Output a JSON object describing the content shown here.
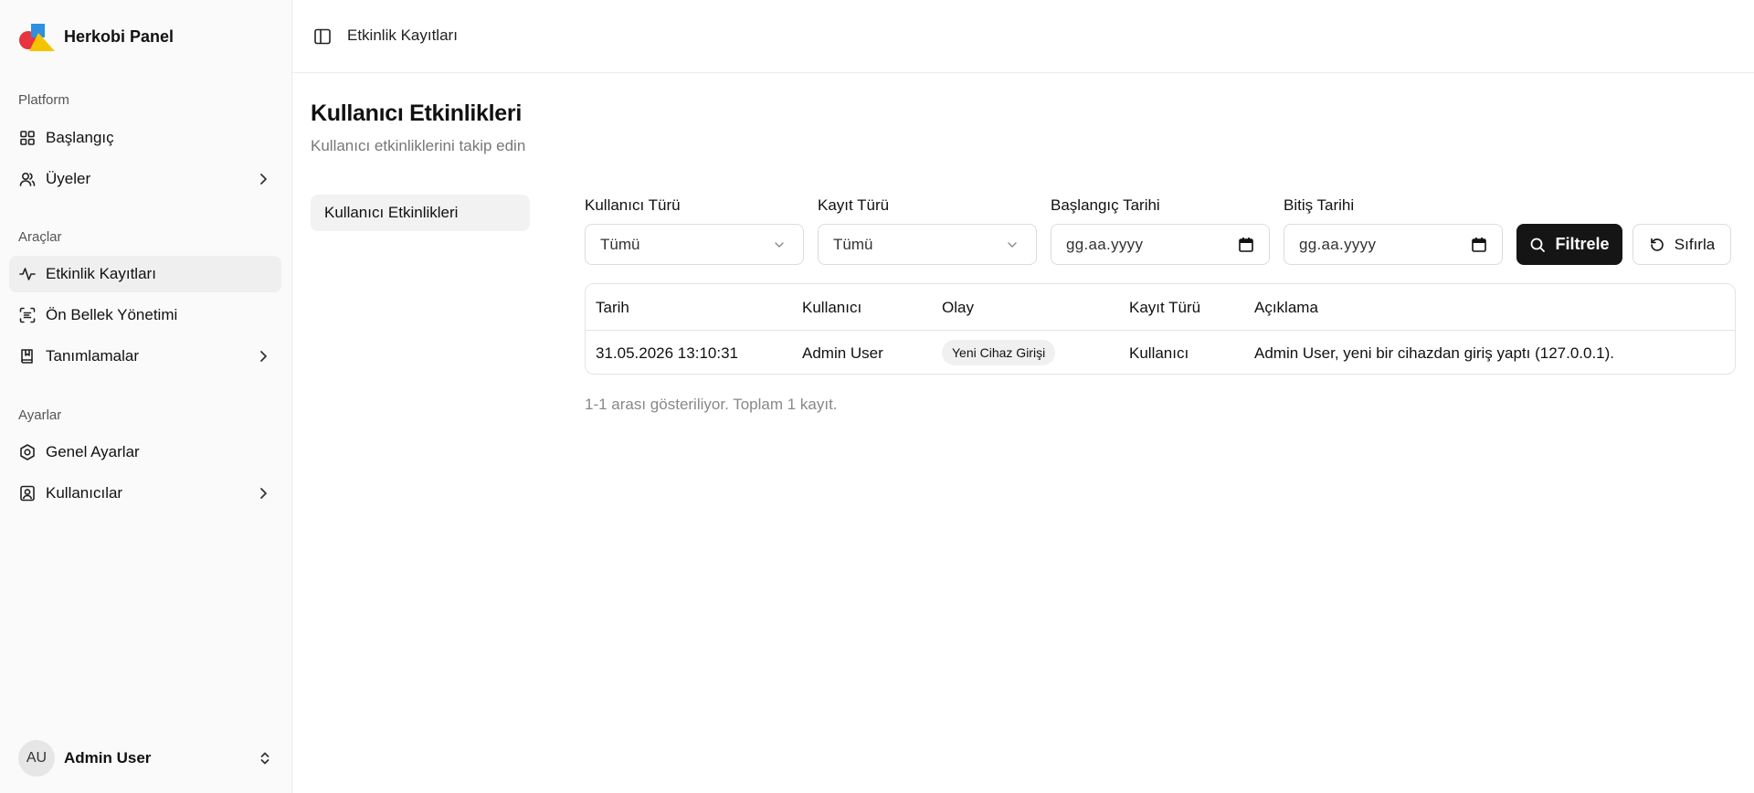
{
  "app": {
    "name": "Herkobi Panel"
  },
  "sidebar": {
    "groups": [
      {
        "label": "Platform"
      },
      {
        "label": "Araçlar"
      },
      {
        "label": "Ayarlar"
      }
    ],
    "items": [
      {
        "label": "Başlangıç",
        "icon": "grid-icon"
      },
      {
        "label": "Üyeler",
        "icon": "users-icon"
      },
      {
        "label": "Etkinlik Kayıtları",
        "icon": "activity-icon",
        "active": true
      },
      {
        "label": "Ön Bellek Yönetimi",
        "icon": "scan-text-icon"
      },
      {
        "label": "Tanımlamalar",
        "icon": "book-icon"
      },
      {
        "label": "Genel Ayarlar",
        "icon": "hexagon-settings-icon"
      },
      {
        "label": "Kullanıcılar",
        "icon": "contact-icon"
      }
    ],
    "user": {
      "initials": "AU",
      "name": "Admin User"
    }
  },
  "header": {
    "title": "Etkinlik Kayıtları"
  },
  "page": {
    "title": "Kullanıcı Etkinlikleri",
    "subtitle": "Kullanıcı etkinliklerini takip edin",
    "subnav": {
      "label": "Kullanıcı Etkinlikleri"
    }
  },
  "filters": {
    "user_type": {
      "label": "Kullanıcı Türü",
      "value": "Tümü"
    },
    "log_type": {
      "label": "Kayıt Türü",
      "value": "Tümü"
    },
    "start_date": {
      "label": "Başlangıç Tarihi",
      "placeholder": "gg.aa.yyyy"
    },
    "end_date": {
      "label": "Bitiş Tarihi",
      "placeholder": "gg.aa.yyyy"
    },
    "filter_button": "Filtrele",
    "reset_button": "Sıfırla"
  },
  "table": {
    "columns": [
      "Tarih",
      "Kullanıcı",
      "Olay",
      "Kayıt Türü",
      "Açıklama"
    ],
    "rows": [
      {
        "date": "31.05.2026 13:10:31",
        "user": "Admin User",
        "event": "Yeni Cihaz Girişi",
        "log_type": "Kullanıcı",
        "description": "Admin User, yeni bir cihazdan giriş yaptı (127.0.0.1)."
      }
    ]
  },
  "pagination": {
    "summary": "1-1 arası gösteriliyor. Toplam 1 kayıt."
  },
  "colors": {
    "primary_button": "#151515",
    "sidebar_bg": "#fafafa",
    "logo_blue": "#2f8fe0",
    "logo_red": "#e8343f",
    "logo_yellow": "#f5c400"
  }
}
